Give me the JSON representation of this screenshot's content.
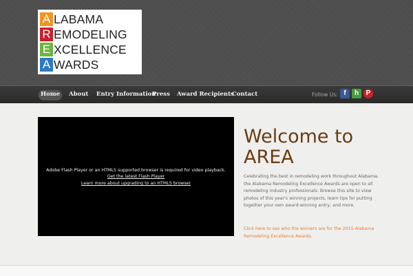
{
  "logo": {
    "letters": [
      "A",
      "R",
      "E",
      "A"
    ],
    "words": [
      "LABAMA",
      "EMODELING",
      "XCELLENCE",
      "WARDS"
    ],
    "letter_colors": [
      "#f2941e",
      "#c8202f",
      "#6fb43f",
      "#2a7bbf"
    ]
  },
  "nav": {
    "items": [
      "Home",
      "About",
      "Entry Information",
      "Press",
      "Award Recipients",
      "Contact"
    ],
    "follow_label": "Follow Us:",
    "social_icons": [
      "facebook-icon",
      "houzz-icon",
      "pinterest-icon"
    ]
  },
  "video": {
    "message": "Adobe Flash Player or an HTML5 supported browser is required for video playback.",
    "link1": "Get the latest Flash Player",
    "link2": "Learn more about upgrading to an HTML5 browser"
  },
  "main": {
    "heading": "Welcome to AREA",
    "body": "Celebrating the best in remodeling work throughout Alabama, the Alabama Remodeling Excellence Awards are open to all remodeling industry professionals. Browse this site to view photos of this year's winning projects, learn tips for putting together your own award-winning entry, and more.",
    "winners_link": "Click here to see who the winners are for the 2015 Alabama Remodeling Excellence Awards."
  },
  "colors": {
    "heading": "#6a3b12",
    "link": "#ee7b2a",
    "nav_bg": "#2f2f2f"
  }
}
